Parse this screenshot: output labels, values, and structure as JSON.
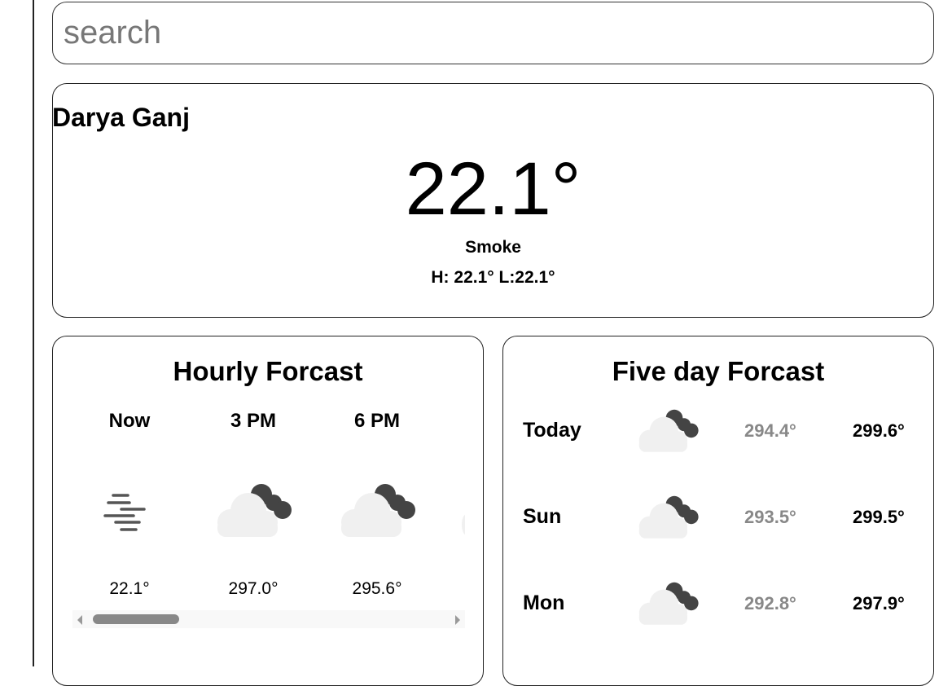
{
  "search": {
    "placeholder": "search"
  },
  "current": {
    "city": "Darya Ganj",
    "temperature": "22.1°",
    "condition": "Smoke",
    "high_low": "H: 22.1° L:22.1°"
  },
  "hourly": {
    "title": "Hourly Forcast",
    "items": [
      {
        "label": "Now",
        "icon": "fog-icon",
        "temp": "22.1°"
      },
      {
        "label": "3 PM",
        "icon": "partly-cloudy-icon",
        "temp": "297.0°"
      },
      {
        "label": "6 PM",
        "icon": "partly-cloudy-icon",
        "temp": "295.6°"
      }
    ],
    "scroll_fraction": 0.0
  },
  "five_day": {
    "title": "Five day Forcast",
    "items": [
      {
        "day": "Today",
        "icon": "partly-cloudy-icon",
        "low": "294.4°",
        "high": "299.6°"
      },
      {
        "day": "Sun",
        "icon": "partly-cloudy-icon",
        "low": "293.5°",
        "high": "299.5°"
      },
      {
        "day": "Mon",
        "icon": "partly-cloudy-icon",
        "low": "292.8°",
        "high": "297.9°"
      }
    ]
  },
  "colors": {
    "low_temp": "#888888",
    "cloud_light": "#f0f0f0",
    "cloud_dark": "#444444"
  }
}
